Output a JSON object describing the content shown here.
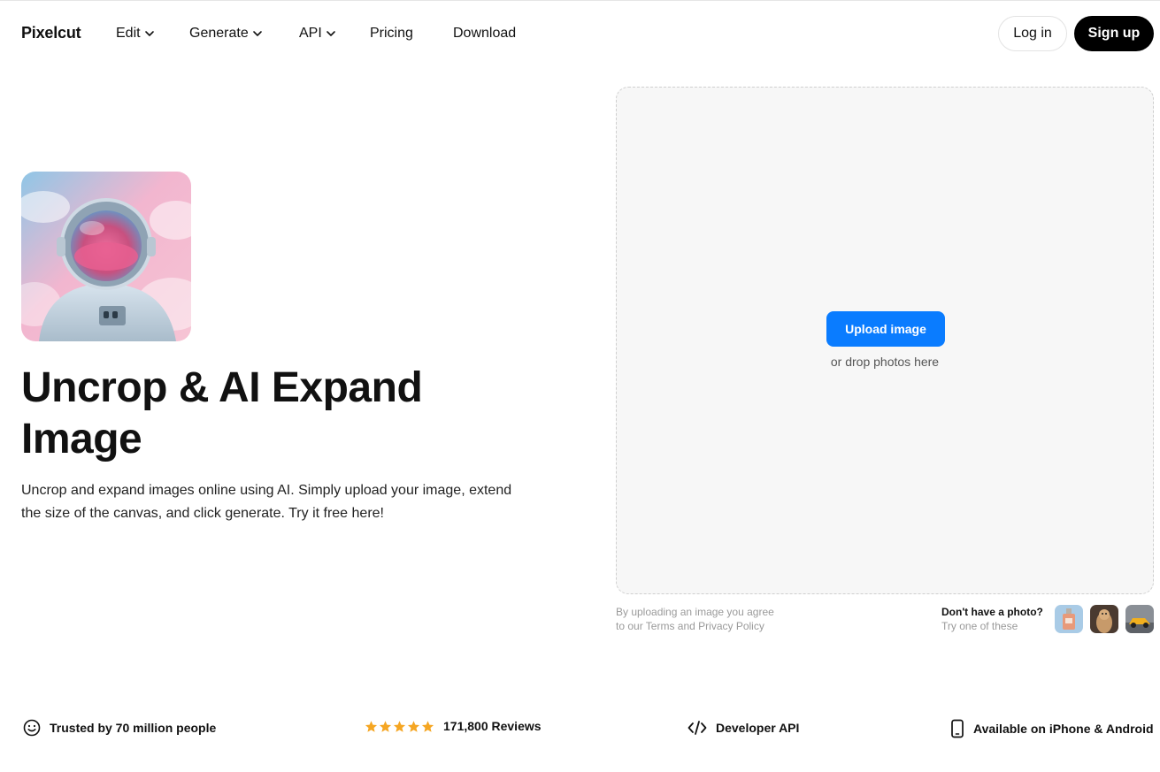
{
  "nav": {
    "logo": "Pixelcut",
    "items": [
      {
        "label": "Edit",
        "dropdown": true
      },
      {
        "label": "Generate",
        "dropdown": true
      },
      {
        "label": "API",
        "dropdown": true
      },
      {
        "label": "Pricing",
        "dropdown": false
      },
      {
        "label": "Download",
        "dropdown": false
      }
    ],
    "login_label": "Log in",
    "signup_label": "Sign up"
  },
  "hero": {
    "title": "Uncrop & AI Expand Image",
    "description": "Uncrop and expand images online using AI. Simply upload your image, extend the size of the canvas, and click generate. Try it free here!",
    "image_icon": "astronaut-image"
  },
  "upload": {
    "button_label": "Upload image",
    "drop_hint": "or drop photos here",
    "terms_line1": "By uploading an image you agree",
    "terms_line2": "to our Terms and Privacy Policy",
    "sample_question": "Don't have a photo?",
    "sample_hint": "Try one of these"
  },
  "features": [
    {
      "icon": "smiley-icon",
      "label": "Trusted by 70 million people"
    },
    {
      "icon": "star-icon",
      "label": "171,800 Reviews",
      "rating": 5
    },
    {
      "icon": "code-icon",
      "label": "Developer API"
    },
    {
      "icon": "phone-icon",
      "label": "Available on iPhone & Android"
    }
  ],
  "colors": {
    "accent": "#0a7cff",
    "star": "#f5a623",
    "upload_bg": "#f7f7f7"
  }
}
